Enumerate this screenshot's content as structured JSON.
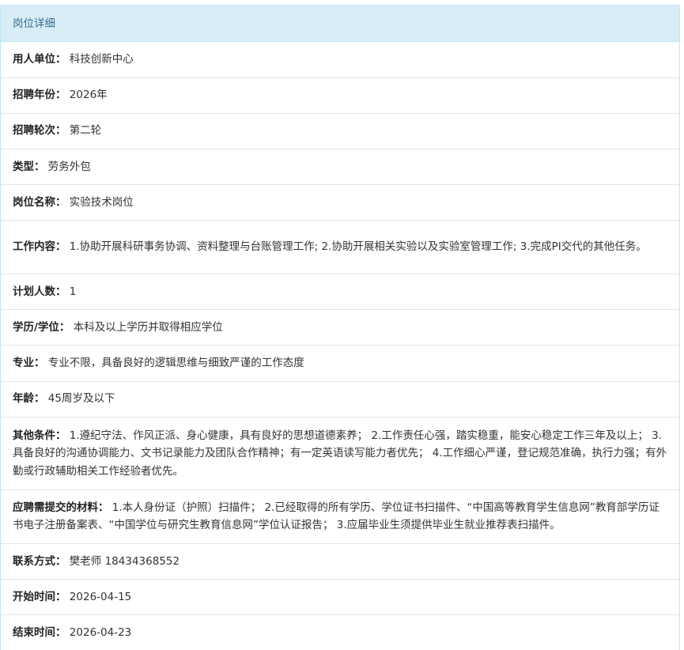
{
  "panel": {
    "title": "岗位详细"
  },
  "fields": {
    "unit": {
      "label": "用人单位：",
      "value": "科技创新中心"
    },
    "year": {
      "label": "招聘年份：",
      "value": "2026年"
    },
    "round": {
      "label": "招聘轮次：",
      "value": "第二轮"
    },
    "type": {
      "label": "类型：",
      "value": "劳务外包"
    },
    "position_name": {
      "label": "岗位名称：",
      "value": "实验技术岗位"
    },
    "job_content": {
      "label": "工作内容：",
      "value": "1.协助开展科研事务协调、资料整理与台账管理工作; 2.协助开展相关实验以及实验室管理工作; 3.完成PI交代的其他任务。"
    },
    "planned_count": {
      "label": "计划人数：",
      "value": "1"
    },
    "education": {
      "label": "学历/学位：",
      "value": "本科及以上学历并取得相应学位"
    },
    "major": {
      "label": "专业：",
      "value": "专业不限，具备良好的逻辑思维与细致严谨的工作态度"
    },
    "age": {
      "label": "年龄：",
      "value": "45周岁及以下"
    },
    "other_conditions": {
      "label": "其他条件：",
      "value": "1.遵纪守法、作风正派、身心健康，具有良好的思想道德素养； 2.工作责任心强，踏实稳重，能安心稳定工作三年及以上； 3.具备良好的沟通协调能力、文书记录能力及团队合作精神；有一定英语读写能力者优先； 4.工作细心严谨，登记规范准确，执行力强；有外勤或行政辅助相关工作经验者优先。"
    },
    "materials": {
      "label": "应聘需提交的材料：",
      "value": "1.本人身份证（护照）扫描件； 2.已经取得的所有学历、学位证书扫描件、“中国高等教育学生信息网”教育部学历证书电子注册备案表、“中国学位与研究生教育信息网”学位认证报告； 3.应届毕业生须提供毕业生就业推荐表扫描件。"
    },
    "contact": {
      "label": "联系方式：",
      "value": "樊老师 18434368552"
    },
    "start_time": {
      "label": "开始时间：",
      "value": "2026-04-15"
    },
    "end_time": {
      "label": "结束时间：",
      "value": "2026-04-23"
    }
  }
}
